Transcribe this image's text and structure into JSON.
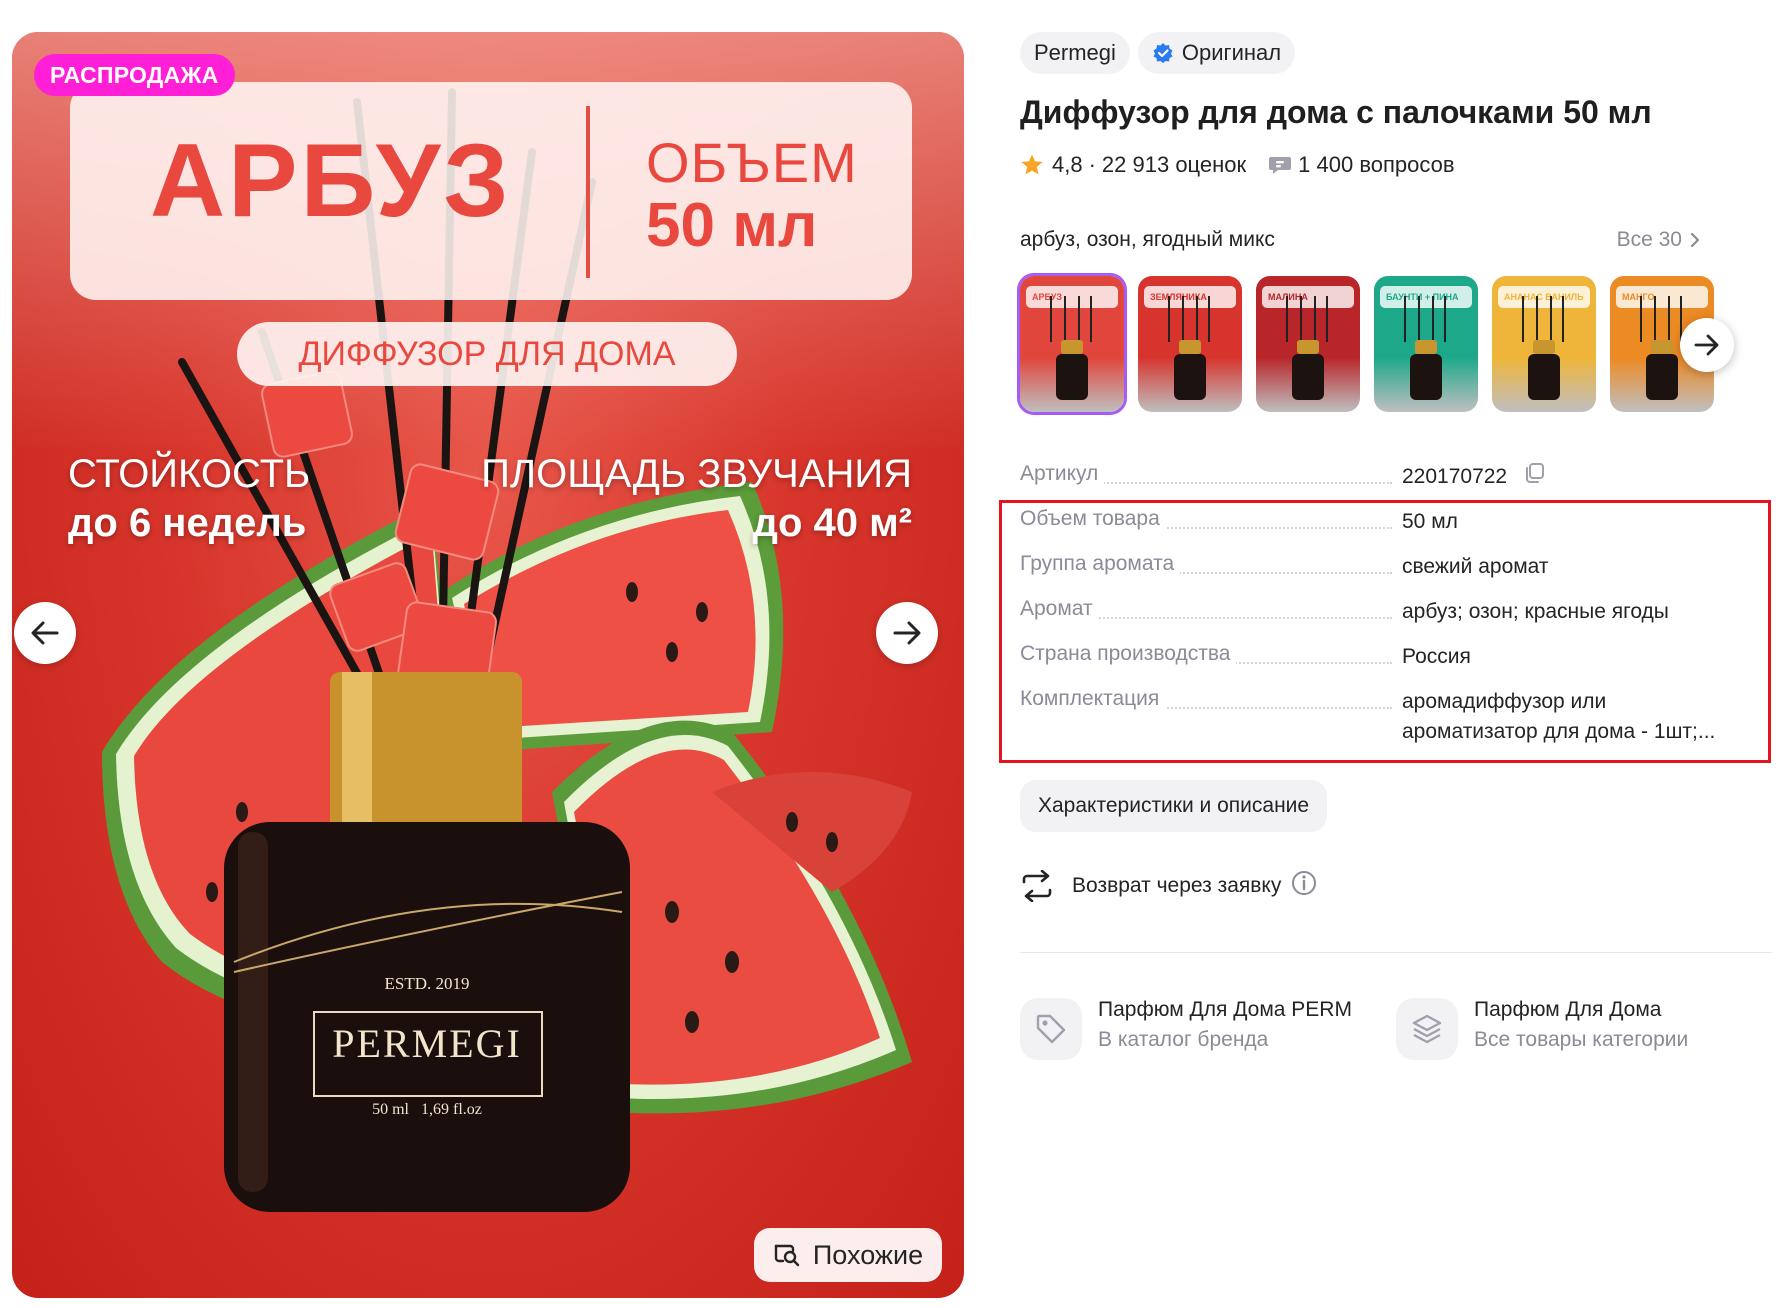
{
  "product_image": {
    "sale_badge": "РАСПРОДАЖА",
    "banner_title": "АРБУЗ",
    "banner_volume_label": "ОБЪЕМ",
    "banner_volume_value": "50 мл",
    "subtitle_pill": "ДИФФУЗОР ДЛЯ ДОМА",
    "feature_left_line1": "СТОЙКОСТЬ",
    "feature_left_line2": "до 6 недель",
    "feature_right_line1": "ПЛОЩАДЬ ЗВУЧАНИЯ",
    "feature_right_line2": "до 40 м²",
    "bottle_estd": "ESTD. 2019",
    "bottle_brand": "PERMEGI",
    "bottle_volume": "50 ml   1,69 fl.oz",
    "similar_button": "Похожие"
  },
  "header": {
    "brand_chip": "Permegi",
    "original_chip": "Оригинал",
    "title": "Диффузор для дома с палочками 50 мл",
    "rating": "4,8",
    "reviews": "22 913 оценок",
    "questions": "1 400 вопросов"
  },
  "variants": {
    "selected_label": "арбуз, озон, ягодный микс",
    "all_link": "Все 30",
    "thumbnails": [
      {
        "label": "АРБУЗ",
        "bg": "#e0463c"
      },
      {
        "label": "ЗЕМЛЯНИКА",
        "bg": "#d8342e"
      },
      {
        "label": "МАЛИНА",
        "bg": "#b8262a"
      },
      {
        "label": "БАУНТИ + ПИНА КОЛАДА",
        "bg": "#1ea88a"
      },
      {
        "label": "АНАНАС ВАНИЛЬ",
        "bg": "#efb53a"
      },
      {
        "label": "МАНГО",
        "bg": "#ec8a24"
      }
    ]
  },
  "specs": [
    {
      "label": "Артикул",
      "value": "220170722"
    },
    {
      "label": "Объем товара",
      "value": "50 мл"
    },
    {
      "label": "Группа аромата",
      "value": "свежий аромат"
    },
    {
      "label": "Аромат",
      "value": "арбуз; озон; красные ягоды"
    },
    {
      "label": "Страна производства",
      "value": "Россия"
    },
    {
      "label": "Комплектация",
      "value": "аромадиффузор или ароматизатор для дома - 1шт;..."
    }
  ],
  "description_button": "Характеристики и описание",
  "return_text": "Возврат через заявку",
  "links": {
    "brand_title": "Парфюм Для Дома PERM",
    "brand_sub": "В каталог бренда",
    "category_title": "Парфюм Для Дома",
    "category_sub": "Все товары категории"
  },
  "colors": {
    "accent_purple": "#a65cf0",
    "sale_pink": "#ff1fd6",
    "highlight_red": "#e3141f",
    "star": "#f5a623",
    "verified_blue": "#2a7af0"
  }
}
